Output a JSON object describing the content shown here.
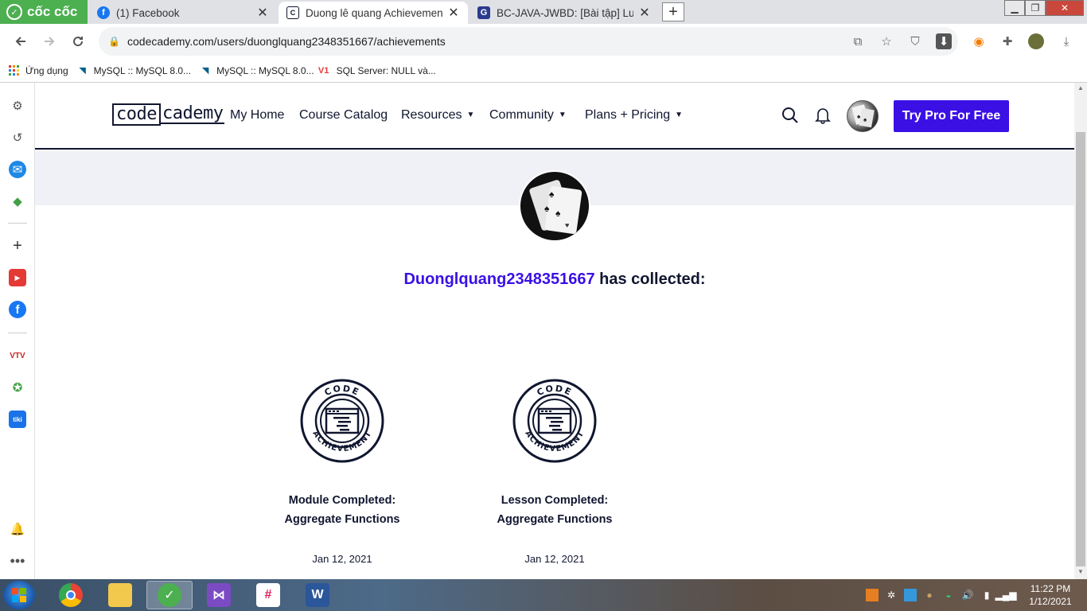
{
  "browser": {
    "brand_name": "cốc cốc",
    "tabs": [
      {
        "title": "(1) Facebook",
        "favicon": "facebook-icon"
      },
      {
        "title": "Duong lê quang Achievements",
        "favicon": "codecademy-icon"
      },
      {
        "title": "BC-JAVA-JWBD: [Bài tập] Luyện",
        "favicon": "codegym-icon"
      }
    ],
    "new_tab_label": "+",
    "url": "codecademy.com/users/duonglquang2348351667/achievements",
    "bookmarks": [
      {
        "label": "Ứng dụng",
        "icon": "apps-grid-icon"
      },
      {
        "label": "MySQL :: MySQL 8.0...",
        "icon": "mysql-icon"
      },
      {
        "label": "MySQL :: MySQL 8.0...",
        "icon": "mysql-icon"
      },
      {
        "label": "SQL Server: NULL và...",
        "icon": "v1-icon",
        "icon_text": "V1"
      }
    ]
  },
  "site": {
    "logo_code": "code",
    "logo_cademy": "cademy",
    "nav": {
      "my_home": "My Home",
      "course_catalog": "Course Catalog",
      "resources": "Resources",
      "community": "Community",
      "plans": "Plans + Pricing"
    },
    "cta": "Try Pro For Free",
    "accent": "#3a10e5"
  },
  "profile": {
    "username": "Duonglquang2348351667",
    "collected_suffix": " has collected:"
  },
  "achievements": [
    {
      "title_line1": "Module Completed:",
      "title_line2": "Aggregate Functions",
      "date": "Jan 12, 2021",
      "badge_top": "CODE",
      "badge_bottom": "ACHIEVEMENT"
    },
    {
      "title_line1": "Lesson Completed:",
      "title_line2": "Aggregate Functions",
      "date": "Jan 12, 2021",
      "badge_top": "CODE",
      "badge_bottom": "ACHIEVEMENT"
    }
  ],
  "taskbar": {
    "time": "11:22 PM",
    "date": "1/12/2021"
  }
}
